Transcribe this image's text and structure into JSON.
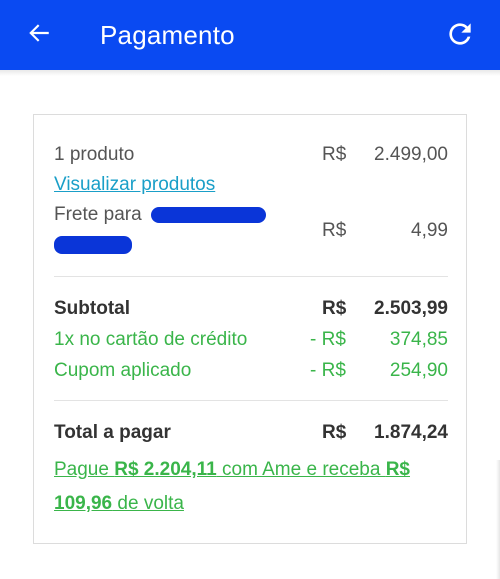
{
  "header": {
    "title": "Pagamento",
    "back_icon": "arrow-left-icon",
    "refresh_icon": "refresh-icon",
    "background_color": "#0a4af2"
  },
  "summary": {
    "products": {
      "label": "1 produto",
      "currency": "R$",
      "amount": "2.499,00"
    },
    "view_products_link": "Visualizar produtos",
    "shipping": {
      "label": "Frete para",
      "currency": "R$",
      "amount": "4,99"
    },
    "subtotal": {
      "label": "Subtotal",
      "currency": "R$",
      "amount": "2.503,99"
    },
    "card_discount": {
      "label": "1x no cartão de crédito",
      "currency": "- R$",
      "amount": "374,85"
    },
    "coupon_discount": {
      "label": "Cupom aplicado",
      "currency": "- R$",
      "amount": "254,90"
    },
    "total": {
      "label": "Total a pagar",
      "currency": "R$",
      "amount": "1.874,24"
    },
    "promo": {
      "prefix": "Pague ",
      "pay_amount": "R$ 2.204,11",
      "middle": " com Ame e receba ",
      "cashback_amount": "R$ 109,96",
      "suffix": " de volta"
    }
  },
  "colors": {
    "accent_blue": "#0a4af2",
    "link_blue": "#1a9fc8",
    "discount_green": "#3ab54a"
  }
}
